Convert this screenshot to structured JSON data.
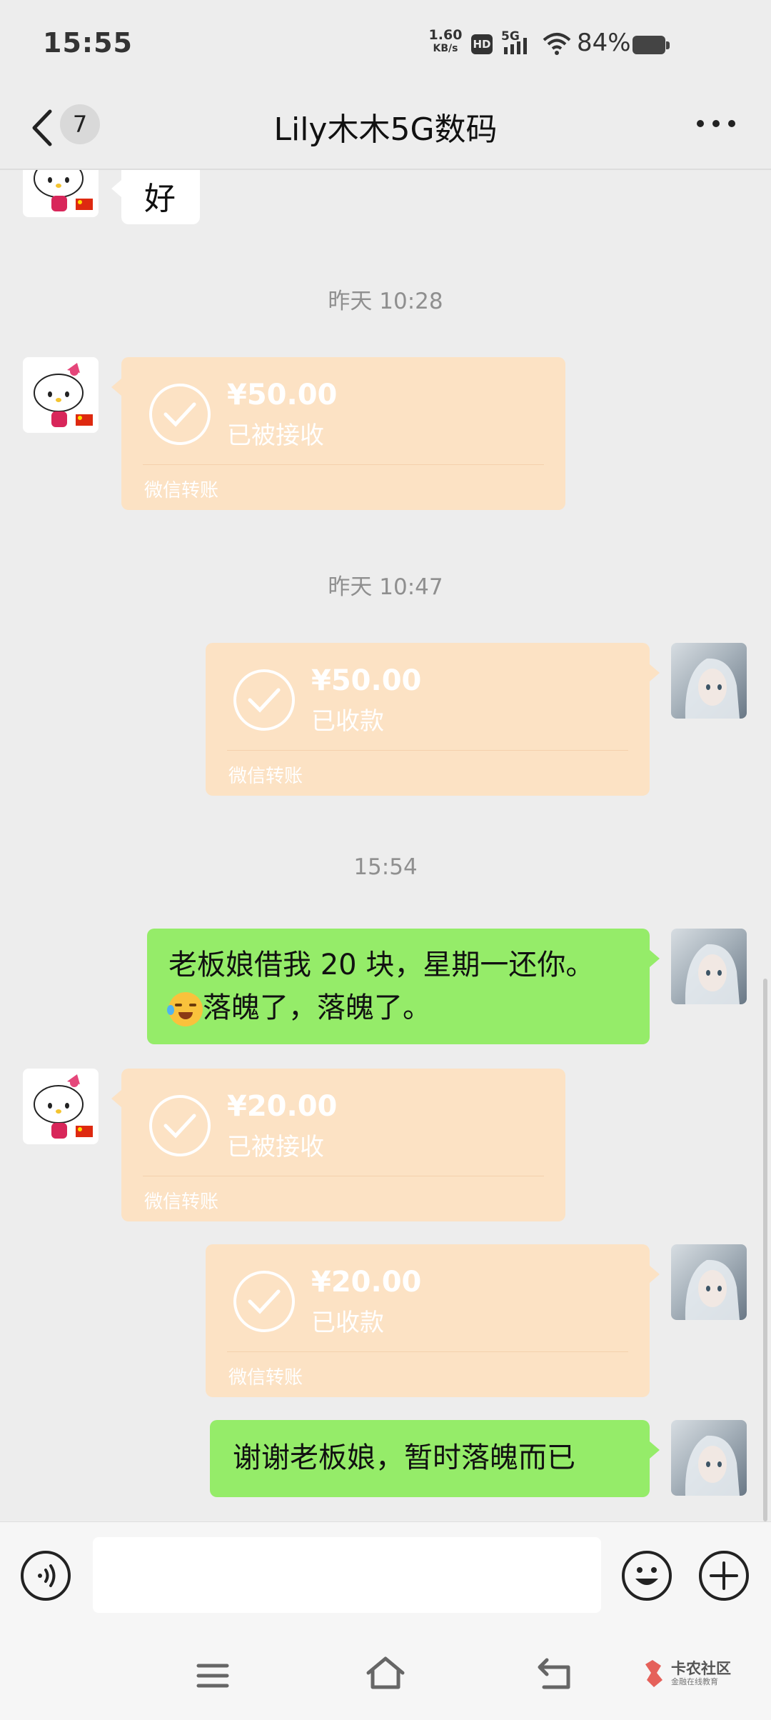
{
  "status_bar": {
    "time": "15:55",
    "net_speed_value": "1.60",
    "net_speed_unit": "KB/s",
    "hd_badge": "HD",
    "network_type": "5G",
    "battery_percent": "84%",
    "battery_level": 0.84
  },
  "header": {
    "unread_count": "7",
    "title": "Lily木木5G数码"
  },
  "messages": [
    {
      "type": "text",
      "side": "left",
      "text": "好"
    },
    {
      "type": "time",
      "text": "昨天 10:28"
    },
    {
      "type": "transfer",
      "side": "left",
      "amount": "¥50.00",
      "status": "已被接收",
      "label": "微信转账"
    },
    {
      "type": "time",
      "text": "昨天 10:47"
    },
    {
      "type": "transfer",
      "side": "right",
      "amount": "¥50.00",
      "status": "已收款",
      "label": "微信转账"
    },
    {
      "type": "time",
      "text": "15:54"
    },
    {
      "type": "text",
      "side": "right",
      "line1": "老板娘借我 20 块，星期一还你。",
      "line2": "落魄了，落魄了。",
      "emoji": "😭"
    },
    {
      "type": "transfer",
      "side": "left",
      "amount": "¥20.00",
      "status": "已被接收",
      "label": "微信转账"
    },
    {
      "type": "transfer",
      "side": "right",
      "amount": "¥20.00",
      "status": "已收款",
      "label": "微信转账"
    },
    {
      "type": "text",
      "side": "right",
      "text": "谢谢老板娘，暂时落魄而已"
    }
  ],
  "watermark": {
    "title": "卡农社区",
    "subtitle": "金融在线教育"
  },
  "colors": {
    "chat_bg": "#ededed",
    "sent_bubble": "#95ec69",
    "transfer_card": "#fce2c4",
    "timestamp": "#8f8f8f"
  },
  "icons": [
    "back-chevron-icon",
    "more-dots-icon",
    "voice-icon",
    "emoji-icon",
    "plus-icon",
    "menu-icon",
    "home-icon",
    "back-icon",
    "check-circle-icon"
  ]
}
